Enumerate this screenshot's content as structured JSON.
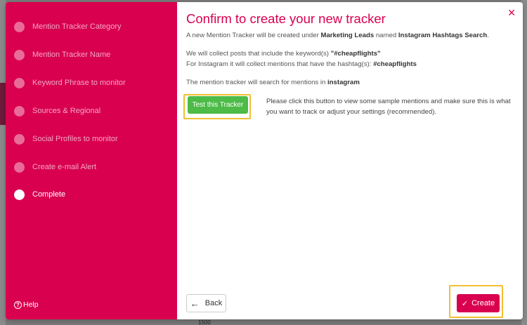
{
  "wizard": {
    "steps": [
      {
        "label": "Mention Tracker Category",
        "active": false
      },
      {
        "label": "Mention Tracker Name",
        "active": false
      },
      {
        "label": "Keyword Phrase to monitor",
        "active": false
      },
      {
        "label": "Sources & Regional",
        "active": false
      },
      {
        "label": "Social Profiles to monitor",
        "active": false
      },
      {
        "label": "Create e-mail Alert",
        "active": false
      },
      {
        "label": "Complete",
        "active": true
      }
    ],
    "help_label": "Help",
    "help_icon": "question-circle-icon"
  },
  "confirm": {
    "title": "Confirm to create your new tracker",
    "intro_prefix": "A new Mention Tracker will be created under ",
    "category": "Marketing Leads",
    "intro_middle": " named ",
    "tracker_name": "Instagram Hashtags Search",
    "intro_suffix": ".",
    "keyword_prefix": "We will collect posts that include the keyword(s) ",
    "keyword": "\"#cheapflights\"",
    "hashtag_prefix": "For Instagram it will collect mentions that have the hashtag(s): ",
    "hashtag": "#cheapflights",
    "search_prefix": "The mention tracker will search for mentions in ",
    "platform": "instagram",
    "test_button": "Test this Tracker",
    "test_description": "Please click this button to view some sample mentions and make sure this is what you want to track or adjust your settings (recommended).",
    "back_button": "Back",
    "create_button": "Create",
    "close_icon": "close-icon"
  },
  "background": {
    "axis_label": "1500"
  },
  "colors": {
    "brand": "#d9004f",
    "success": "#4cbb47",
    "highlight": "#f2bf30"
  }
}
